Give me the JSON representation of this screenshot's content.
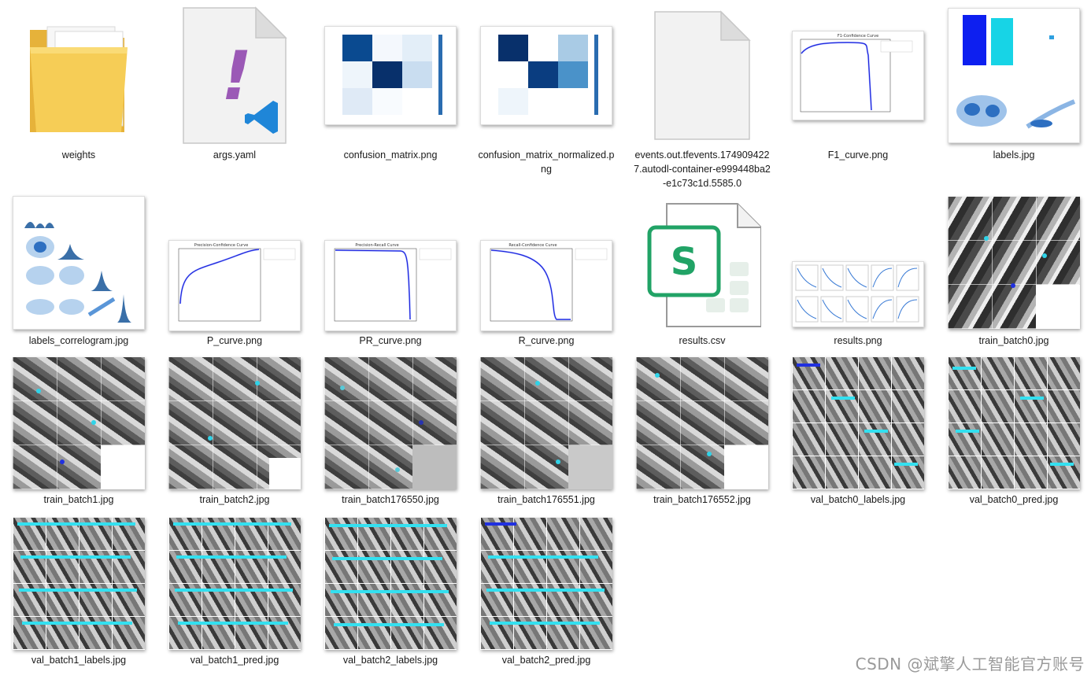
{
  "files": [
    {
      "name": "weights",
      "kind": "folder"
    },
    {
      "name": "args.yaml",
      "kind": "yaml"
    },
    {
      "name": "confusion_matrix.png",
      "kind": "heatmap"
    },
    {
      "name": "confusion_matrix_normalized.png",
      "kind": "heatmap"
    },
    {
      "name": "events.out.tfevents.1749094227.autodl-container-e999448ba2-e1c73c1d.5585.0",
      "kind": "blank"
    },
    {
      "name": "F1_curve.png",
      "kind": "curve"
    },
    {
      "name": "labels.jpg",
      "kind": "labels"
    },
    {
      "name": "labels_correlogram.jpg",
      "kind": "correlogram"
    },
    {
      "name": "P_curve.png",
      "kind": "curve"
    },
    {
      "name": "PR_curve.png",
      "kind": "curve"
    },
    {
      "name": "R_curve.png",
      "kind": "curve"
    },
    {
      "name": "results.csv",
      "kind": "csv"
    },
    {
      "name": "results.png",
      "kind": "results"
    },
    {
      "name": "train_batch0.jpg",
      "kind": "mosaic"
    },
    {
      "name": "train_batch1.jpg",
      "kind": "mosaic"
    },
    {
      "name": "train_batch2.jpg",
      "kind": "mosaic"
    },
    {
      "name": "train_batch176550.jpg",
      "kind": "mosaic"
    },
    {
      "name": "train_batch176551.jpg",
      "kind": "mosaic"
    },
    {
      "name": "train_batch176552.jpg",
      "kind": "mosaic"
    },
    {
      "name": "val_batch0_labels.jpg",
      "kind": "val"
    },
    {
      "name": "val_batch0_pred.jpg",
      "kind": "val"
    },
    {
      "name": "val_batch1_labels.jpg",
      "kind": "val"
    },
    {
      "name": "val_batch1_pred.jpg",
      "kind": "val"
    },
    {
      "name": "val_batch2_labels.jpg",
      "kind": "val"
    },
    {
      "name": "val_batch2_pred.jpg",
      "kind": "val"
    }
  ],
  "thumbnail_text": {
    "csv_letter": "S",
    "yaml_mark": "!",
    "f1_title": "F1-Confidence Curve",
    "p_title": "Precision-Confidence Curve",
    "pr_title": "Precision-Recall Curve",
    "r_title": "Recall-Confidence Curve"
  },
  "watermark": "CSDN @斌擎人工智能官方账号",
  "colors": {
    "folder": "#f3c54a",
    "yaml_mark": "#9b59b6",
    "vscode_blue": "#1f86d8",
    "csv_green": "#21a366",
    "heatmap_dark": "#08306b",
    "curve_blue": "#1a1ad6",
    "label_cyan": "#33e0f0"
  }
}
